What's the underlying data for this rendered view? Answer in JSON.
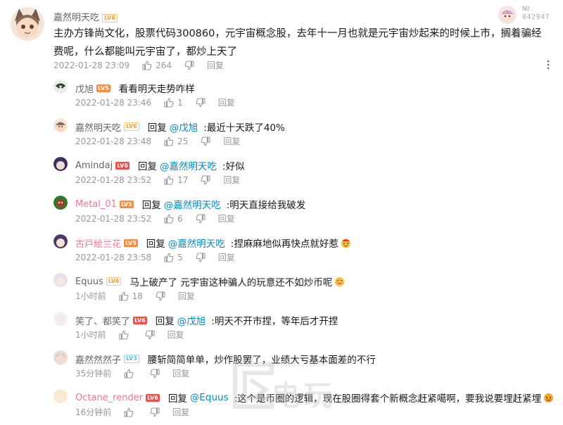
{
  "main_comment": {
    "username": "嘉然明天吃",
    "level": "LV6",
    "badge_no_label": "NO.",
    "badge_number": "042947",
    "text": "主办方锋尚文化，股票代码300860，元宇宙概念股，去年十一月也就是元宇宙炒起来的时候上市，搁着骗经费呢，什么都能叫元宇宙了，都炒上天了",
    "time": "2022-01-28 23:09",
    "likes": "264",
    "reply_label": "回复"
  },
  "replies": [
    {
      "username": "戊旭",
      "level": "LV5",
      "reply_to": "",
      "text": "看看明天走势咋样",
      "time": "2022-01-28 23:46",
      "likes": "1"
    },
    {
      "username": "嘉然明天吃",
      "level": "LV6",
      "reply_to": "@戊旭",
      "text": ":最近十天跌了40%",
      "time": "2022-01-28 23:48",
      "likes": "25"
    },
    {
      "username": "Amindaj",
      "level": "LV6",
      "reply_to": "@嘉然明天吃",
      "text": ":好似",
      "time": "2022-01-28 23:52",
      "likes": "17"
    },
    {
      "username": "Metal_01",
      "level": "LV5",
      "reply_to": "@嘉然明天吃",
      "text": ":明天直接给我破发",
      "time": "2022-01-28 23:52",
      "likes": "6"
    },
    {
      "username": "古戸絵兰花",
      "level": "LV5",
      "reply_to": "@嘉然明天吃",
      "text": ":捏麻麻地似再快点就好惹",
      "time": "2022-01-28 23:58",
      "likes": "5"
    },
    {
      "username": "Equus",
      "level": "LV6",
      "reply_to": "",
      "text": "马上破产了 元宇宙这种骗人的玩意还不如炒币呢",
      "time": "1小时前",
      "likes": "18"
    },
    {
      "username": "笑了、都笑了",
      "level": "LV6",
      "reply_to": "@戊旭",
      "text": ":明天不开市捏，等年后才开捏",
      "time": "1小时前",
      "likes": ""
    },
    {
      "username": "嘉然然然子",
      "level": "LV3",
      "reply_to": "",
      "text": "腰斩简简单单，炒作股罢了，业绩大亏基本面差的不行",
      "time": "35分钟前",
      "likes": ""
    },
    {
      "username": "Octane_render",
      "level": "LV6",
      "reply_to": "@Equus",
      "text": ":这个是币圈的逻辑，现在股圈得套个新概念赶紧噶啊，要我说要埋赶紧埋",
      "time": "16分钟前",
      "likes": ""
    }
  ],
  "reply_prefix": "回复",
  "reply_label": "回复",
  "watermark": {
    "text": "电玩",
    "subtext": "Surround to Watch"
  },
  "colors": {
    "accent": "#00a1d6",
    "mention": "#008ac5",
    "pink": "#fb7299",
    "lv6": "#f04c49",
    "lv5": "#ff8a3d"
  }
}
